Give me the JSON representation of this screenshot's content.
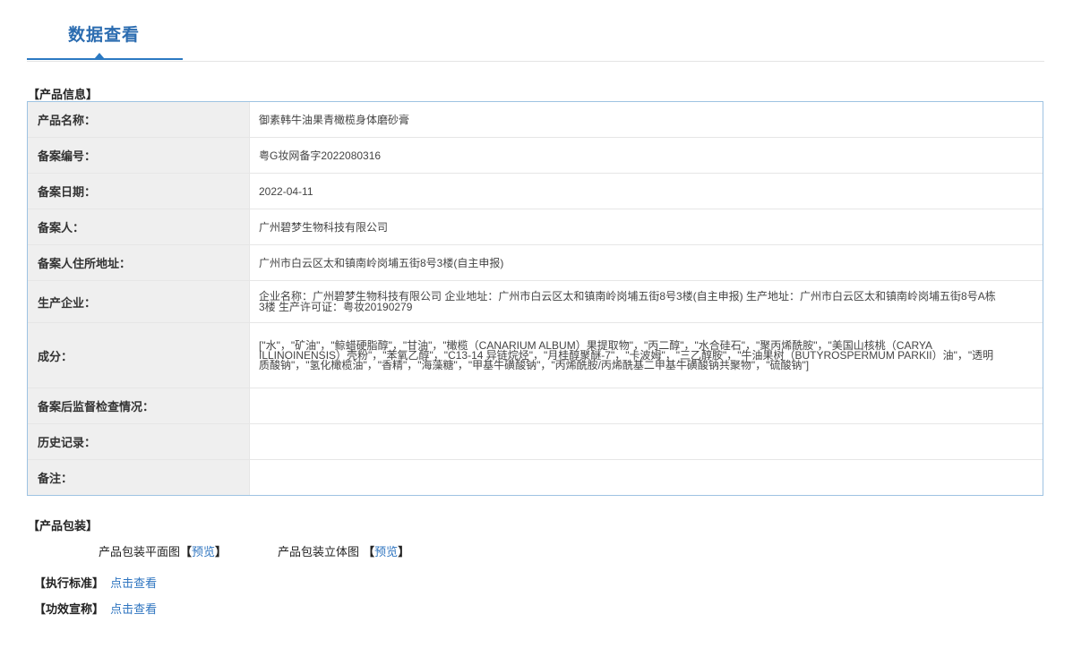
{
  "tab": {
    "title": "数据查看"
  },
  "product_info": {
    "heading": "【产品信息】",
    "rows": [
      {
        "label": "产品名称：",
        "value": "御素韩牛油果青橄榄身体磨砂膏"
      },
      {
        "label": "备案编号：",
        "value": "粤G妆网备字2022080316"
      },
      {
        "label": "备案日期：",
        "value": "2022-04-11"
      },
      {
        "label": "备案人：",
        "value": "广州碧梦生物科技有限公司"
      },
      {
        "label": "备案人住所地址：",
        "value": "广州市白云区太和镇南岭岗埔五街8号3楼(自主申报)"
      },
      {
        "label": "生产企业：",
        "value": "企业名称：广州碧梦生物科技有限公司 企业地址：广州市白云区太和镇南岭岗埔五街8号3楼(自主申报) 生产地址：广州市白云区太和镇南岭岗埔五街8号A栋3楼 生产许可证：粤妆20190279"
      },
      {
        "label": "成分：",
        "value": "[\"水\"，\"矿油\"，\"鲸蜡硬脂醇\"，\"甘油\"，\"橄榄（CANARIUM ALBUM）果提取物\"，\"丙二醇\"，\"水合硅石\"，\"聚丙烯酰胺\"，\"美国山核桃（CARYA ILLINOINENSIS）壳粉\"，\"苯氧乙醇\"，\"C13-14 异链烷烃\"，\"月桂醇聚醚-7\"，\"卡波姆\"，\"三乙醇胺\"，\"牛油果树（BUTYROSPERMUM PARKII）油\"，\"透明质酸钠\"，\"氢化橄榄油\"，\"香精\"，\"海藻糖\"，\"甲基牛磺酸钠\"，\"丙烯酰胺/丙烯酰基二甲基牛磺酸钠共聚物\"，\"硫酸钠\"]"
      },
      {
        "label": "备案后监督检查情况：",
        "value": ""
      },
      {
        "label": "历史记录：",
        "value": ""
      },
      {
        "label": "备注：",
        "value": ""
      }
    ]
  },
  "packaging": {
    "heading": "【产品包装】",
    "flat_label": "产品包装平面图",
    "solid_label": "产品包装立体图",
    "open_bracket": "【",
    "close_bracket": "】",
    "preview": "预览"
  },
  "standard": {
    "label": "【执行标准】",
    "link": "点击查看"
  },
  "claims": {
    "label": "【功效宣称】",
    "link": "点击查看"
  }
}
